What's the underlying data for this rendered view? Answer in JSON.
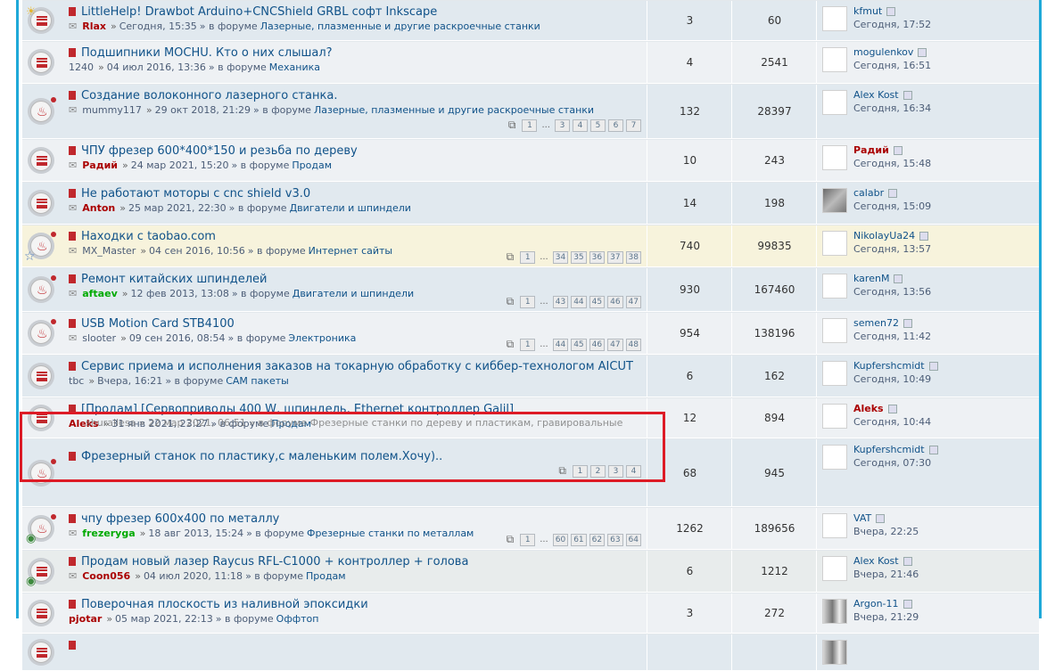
{
  "rows": [
    {
      "icon": "lines",
      "extra": "bulb",
      "bg": "bg2",
      "title": "LittleHelp! Drawbot Arduino+CNCShield GRBL софт Inkscape",
      "clip": true,
      "author": "Rlax",
      "author_color": "red",
      "date": "Сегодня, 15:35",
      "forum_prefix": "» в форуме",
      "forum": "Лазерные, плазменные и другие раскроечные станки",
      "pages": [],
      "replies": "3",
      "views": "60",
      "last_user": "kfmut",
      "last_user_color": "",
      "last_time": "Сегодня, 17:52",
      "avatar": "blank",
      "h": 44
    },
    {
      "icon": "lines",
      "extra": "",
      "bg": "bg1",
      "title": "Подшипники MOCHU. Кто о них слышал?",
      "clip": false,
      "author": "1240",
      "author_color": "plain",
      "date": "04 июл 2016, 13:36",
      "forum_prefix": "» в форуме",
      "forum": "Механика",
      "pages": [],
      "replies": "4",
      "views": "2541",
      "last_user": "mogulenkov",
      "last_user_color": "",
      "last_time": "Сегодня, 16:51",
      "avatar": "blank",
      "h": 46
    },
    {
      "icon": "flame",
      "extra": "",
      "bg": "bg2",
      "title": "Создание волоконного лазерного станка.",
      "clip": true,
      "author": "mummy117",
      "author_color": "plain",
      "date": "29 окт 2018, 21:29",
      "forum_prefix": "» в форуме",
      "forum": "Лазерные, плазменные и другие раскроечные станки",
      "pages": [
        "1",
        "...",
        "3",
        "4",
        "5",
        "6",
        "7"
      ],
      "replies": "132",
      "views": "28397",
      "last_user": "Alex Kost",
      "last_user_color": "",
      "last_time": "Сегодня, 16:34",
      "avatar": "blank",
      "h": 60
    },
    {
      "icon": "lines",
      "extra": "",
      "bg": "bg1",
      "title": "ЧПУ фрезер 600*400*150 и резьба по дереву",
      "clip": true,
      "author": "Радий",
      "author_color": "red",
      "date": "24 мар 2021, 15:20",
      "forum_prefix": "» в форуме",
      "forum": "Продам",
      "pages": [],
      "replies": "10",
      "views": "243",
      "last_user": "Радий",
      "last_user_color": "red",
      "last_time": "Сегодня, 15:48",
      "avatar": "blank",
      "h": 46
    },
    {
      "icon": "lines",
      "extra": "",
      "bg": "bg2",
      "title": "Не работают моторы с cnc shield v3.0",
      "clip": true,
      "author": "Anton",
      "author_color": "red",
      "date": "25 мар 2021, 22:30",
      "forum_prefix": "» в форуме",
      "forum": "Двигатели и шпиндели",
      "pages": [],
      "replies": "14",
      "views": "198",
      "last_user": "calabr",
      "last_user_color": "",
      "last_time": "Сегодня, 15:09",
      "avatar": "img",
      "h": 46
    },
    {
      "icon": "flame",
      "extra": "star",
      "bg": "sticky",
      "title": "Находки с taobao.com",
      "clip": true,
      "author": "MX_Master",
      "author_color": "plain",
      "date": "04 сен 2016, 10:56",
      "forum_prefix": "» в форуме",
      "forum": "Интернет сайты",
      "pages": [
        "1",
        "...",
        "34",
        "35",
        "36",
        "37",
        "38"
      ],
      "replies": "740",
      "views": "99835",
      "last_user": "NikolayUa24",
      "last_user_color": "",
      "last_time": "Сегодня, 13:57",
      "avatar": "blank",
      "h": 46
    },
    {
      "icon": "flame",
      "extra": "",
      "bg": "bg2",
      "title": "Ремонт китайских шпинделей",
      "clip": true,
      "author": "aftaev",
      "author_color": "green",
      "date": "12 фев 2013, 13:08",
      "forum_prefix": "» в форуме",
      "forum": "Двигатели и шпиндели",
      "pages": [
        "1",
        "...",
        "43",
        "44",
        "45",
        "46",
        "47"
      ],
      "replies": "930",
      "views": "167460",
      "last_user": "karenM",
      "last_user_color": "",
      "last_time": "Сегодня, 13:56",
      "avatar": "blank",
      "h": 48
    },
    {
      "icon": "flame",
      "extra": "",
      "bg": "bg1",
      "title": "USB Motion Card STB4100",
      "clip": true,
      "author": "slooter",
      "author_color": "plain",
      "date": "09 сен 2016, 08:54",
      "forum_prefix": "» в форуме",
      "forum": "Электроника",
      "pages": [
        "1",
        "...",
        "44",
        "45",
        "46",
        "47",
        "48"
      ],
      "replies": "954",
      "views": "138196",
      "last_user": "semen72",
      "last_user_color": "",
      "last_time": "Сегодня, 11:42",
      "avatar": "blank",
      "h": 46
    },
    {
      "icon": "lines",
      "extra": "",
      "bg": "bg2",
      "title": "Сервис приема и исполнения заказов на токарную обработку с киббер-технологом AICUT",
      "clip": false,
      "author": "tbc",
      "author_color": "plain",
      "date": "Вчера, 16:21",
      "forum_prefix": "» в форуме",
      "forum": "CAM пакеты",
      "pages": [],
      "replies": "6",
      "views": "162",
      "last_user": "Kupfershcmidt",
      "last_user_color": "",
      "last_time": "Сегодня, 10:49",
      "avatar": "blank",
      "h": 46
    },
    {
      "icon": "lines",
      "extra": "",
      "bg": "bg1",
      "title": "[Продам] [Сервоприводы 400 W, шпиндель, Ethernet контроллер Galil]",
      "clip": false,
      "author": "Aleks",
      "author_color": "red",
      "date": "31 янв 2021, 23:27",
      "forum_prefix": "» в форуме",
      "forum": "Продам",
      "pages": [],
      "replies": "12",
      "views": "894",
      "last_user": "Aleks",
      "last_user_color": "red",
      "last_time": "Сегодня, 10:44",
      "avatar": "blank",
      "h": 44
    },
    {
      "icon": "flame",
      "extra": "",
      "bg": "bg2",
      "title": "Фрезерный станок по пластику,с маленьким полем.Хочу)..",
      "clip": false,
      "author": "",
      "author_color": "plain",
      "date": "",
      "forum_prefix": "",
      "forum": "",
      "pages": [
        "1",
        "2",
        "3",
        "4"
      ],
      "replies": "68",
      "views": "945",
      "last_user": "Kupfershcmidt",
      "last_user_color": "",
      "last_time": "Сегодня, 07:30",
      "avatar": "blank",
      "h": 75
    },
    {
      "icon": "flame",
      "extra": "badge",
      "bg": "bg1",
      "title": "чпу фрезер 600x400 по металлу",
      "clip": true,
      "author": "frezeryga",
      "author_color": "green",
      "date": "18 авг 2013, 15:24",
      "forum_prefix": "» в форуме",
      "forum": "Фрезерные станки по металлам",
      "pages": [
        "1",
        "...",
        "60",
        "61",
        "62",
        "63",
        "64"
      ],
      "replies": "1262",
      "views": "189656",
      "last_user": "VAT",
      "last_user_color": "",
      "last_time": "Вчера, 22:25",
      "avatar": "blank",
      "h": 46
    },
    {
      "icon": "lines",
      "extra": "badge",
      "bg": "green",
      "title": "Продам новый лазер Raycus RFL-C1000 + контроллер + голова",
      "clip": true,
      "author": "Coon056",
      "author_color": "red",
      "date": "04 июл 2020, 11:18",
      "forum_prefix": "» в форуме",
      "forum": "Продам",
      "pages": [],
      "replies": "6",
      "views": "1212",
      "last_user": "Alex Kost",
      "last_user_color": "",
      "last_time": "Вчера, 21:46",
      "avatar": "blank",
      "h": 46
    },
    {
      "icon": "lines",
      "extra": "",
      "bg": "bg1",
      "title": "Поверочная плоскость из наливной эпоксидки",
      "clip": false,
      "author": "pjotar",
      "author_color": "red",
      "date": "05 мар 2021, 22:13",
      "forum_prefix": "» в форуме",
      "forum": "Оффтоп",
      "pages": [],
      "replies": "3",
      "views": "272",
      "last_user": "Argon-11",
      "last_user_color": "",
      "last_time": "Вчера, 21:29",
      "avatar": "img2",
      "h": 44
    },
    {
      "icon": "lines",
      "extra": "",
      "bg": "bg2",
      "title": "",
      "clip": false,
      "author": "",
      "author_color": "plain",
      "date": "",
      "forum_prefix": "",
      "forum": "",
      "pages": [],
      "replies": "",
      "views": "",
      "last_user": "",
      "last_user_color": "",
      "last_time": "",
      "avatar": "img2",
      "h": 40
    }
  ],
  "ghost_text": "shurallesa » 22 мар 2021, 06:51 » в форуме Фрезерные станки по дереву и пластикам, гравировальные"
}
